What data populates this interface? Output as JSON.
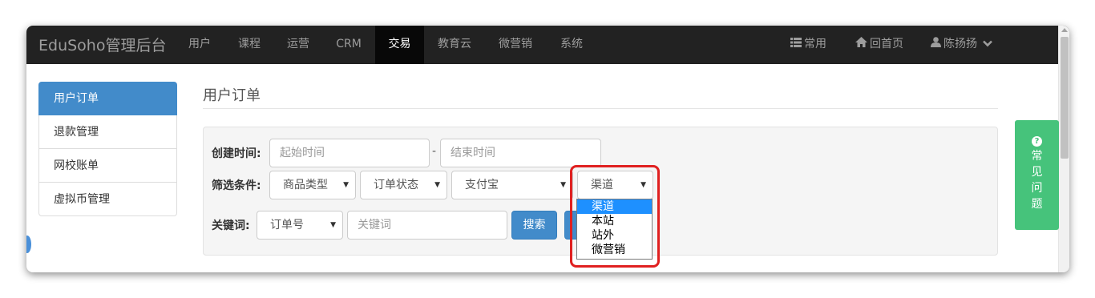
{
  "navbar": {
    "brand": "EduSoho管理后台",
    "items": [
      "用户",
      "课程",
      "运营",
      "CRM",
      "交易",
      "教育云",
      "微营销",
      "系统"
    ],
    "active": "交易",
    "right": [
      {
        "icon": "list-icon",
        "label": "常用"
      },
      {
        "icon": "home-icon",
        "label": "回首页"
      },
      {
        "icon": "user-icon",
        "label": "陈扬扬"
      }
    ]
  },
  "sidebar": {
    "items": [
      {
        "label": "用户订单"
      },
      {
        "label": "退款管理"
      },
      {
        "label": "网校账单"
      },
      {
        "label": "虚拟币管理"
      }
    ]
  },
  "page": {
    "title": "用户订单"
  },
  "filters": {
    "time_label": "创建时间:",
    "start_placeholder": "起始时间",
    "end_placeholder": "结束时间",
    "range_dash": "-",
    "condition_label": "筛选条件:",
    "product_type": "商品类型",
    "order_status": "订单状态",
    "payment": "支付宝",
    "channel": "渠道",
    "keyword_label": "关键词:",
    "keyword_type": "订单号",
    "keyword_placeholder": "关键词",
    "search_button": "搜索"
  },
  "channel_options": [
    "渠道",
    "本站",
    "站外",
    "微营销"
  ],
  "faq": {
    "icon_glyph": "?",
    "label": "常见问题"
  },
  "colors": {
    "navbar": "#222222",
    "primary": "#428bca",
    "faq": "#46c37b",
    "highlight": "#e02020"
  }
}
